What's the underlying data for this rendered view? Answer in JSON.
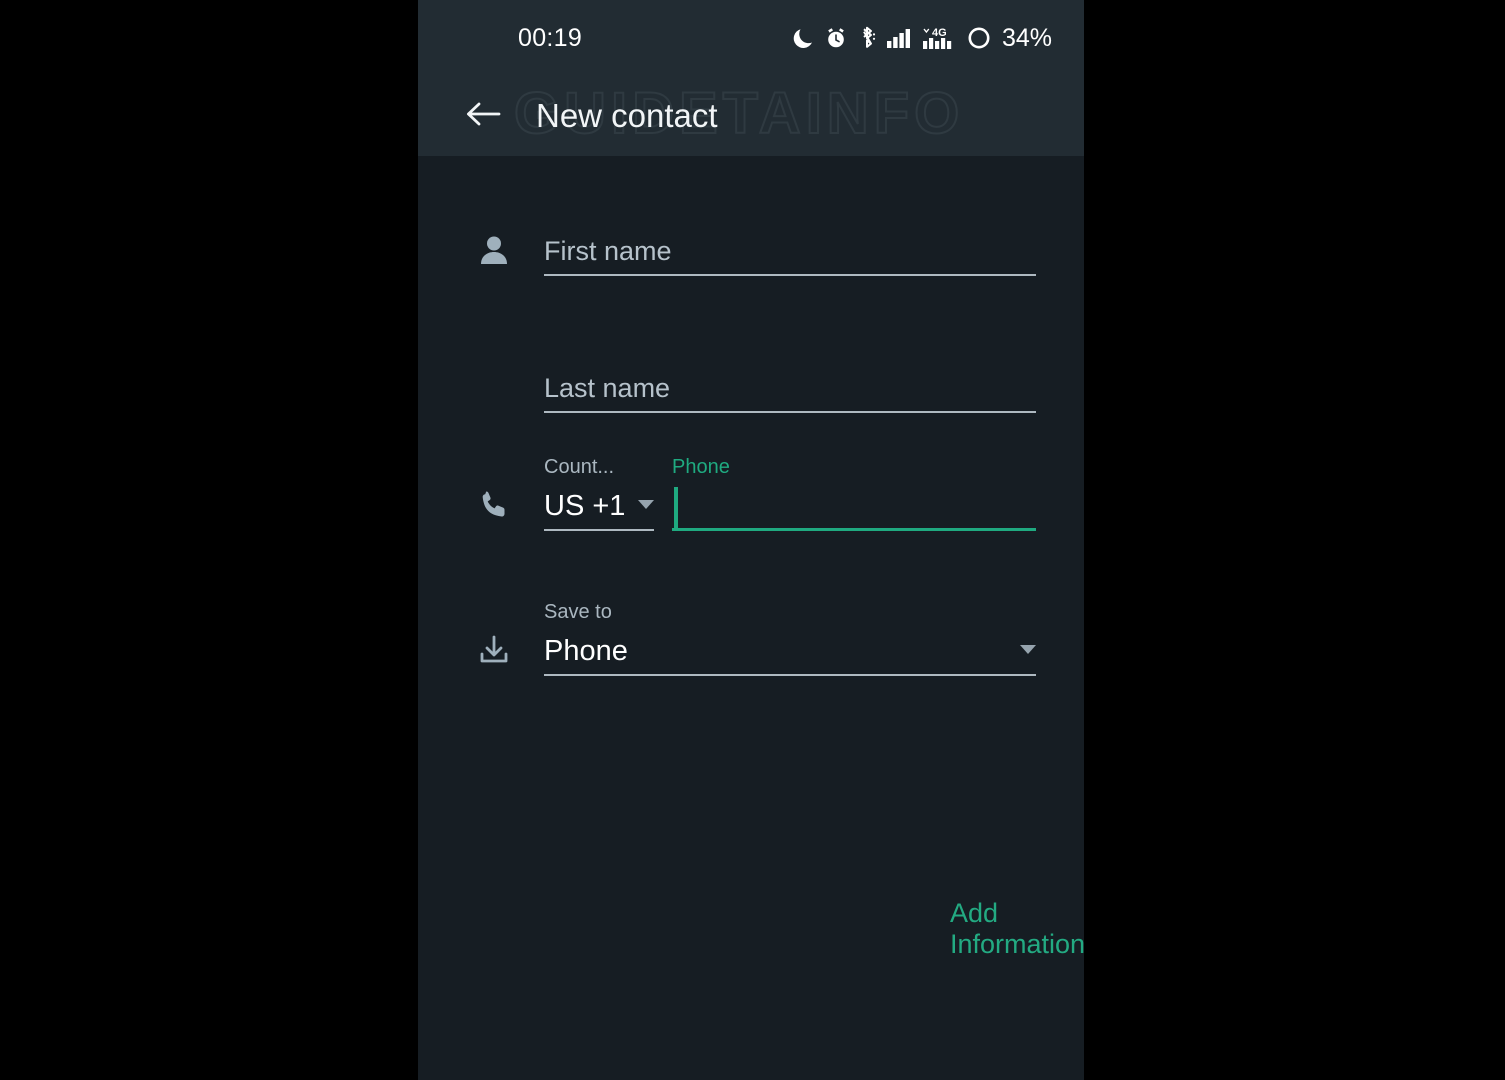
{
  "status_bar": {
    "clock": "00:19",
    "battery_percent": "34%",
    "icons": [
      "do-not-disturb-moon-icon",
      "alarm-clock-icon",
      "bluetooth-icon",
      "signal-bars-icon",
      "signal-4g-icon",
      "battery-circle-icon"
    ],
    "network_label": "4G"
  },
  "toolbar": {
    "title": "New contact",
    "back_icon": "back-arrow-icon",
    "watermark": "GUIDETAINFO"
  },
  "form": {
    "first_name": {
      "icon": "person-icon",
      "placeholder": "First name",
      "value": ""
    },
    "last_name": {
      "placeholder": "Last name",
      "value": ""
    },
    "phone": {
      "icon": "phone-handset-icon",
      "country_label": "Count...",
      "country_value": "US +1",
      "phone_label": "Phone",
      "phone_value": "",
      "focused": true
    },
    "save_to": {
      "icon": "save-download-icon",
      "label": "Save to",
      "value": "Phone"
    },
    "add_information_label": "Add Information"
  },
  "colors": {
    "accent_green": "#1faa80",
    "toolbar_bg": "#222c33",
    "body_bg": "#161d23",
    "letterbox": "#000000",
    "underline": "#aeb9c1",
    "label_gray": "#aab7c0"
  }
}
